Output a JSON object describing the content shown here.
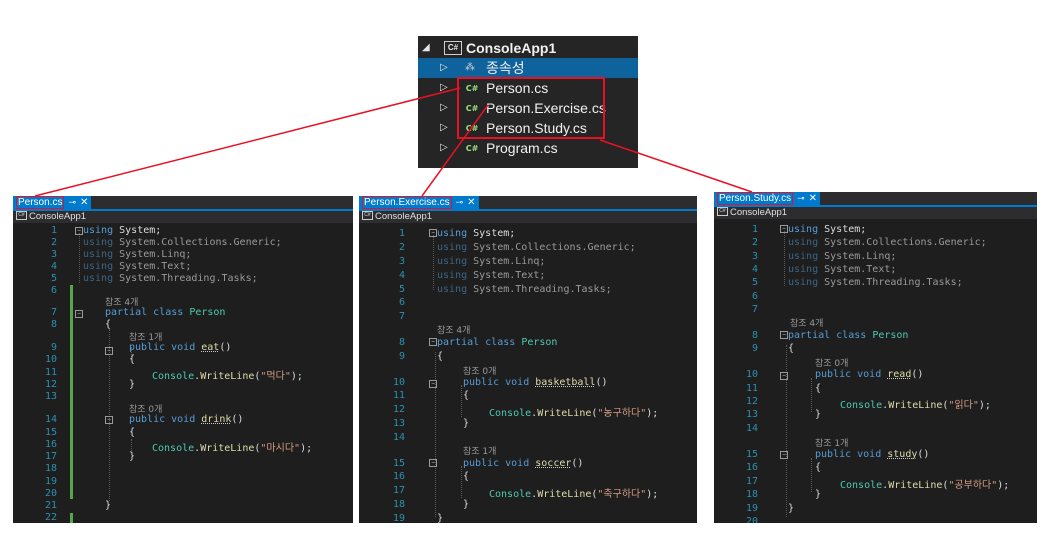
{
  "solution_explorer": {
    "project": "ConsoleApp1",
    "dependencies": "종속성",
    "files": [
      "Person.cs",
      "Person.Exercise.cs",
      "Person.Study.cs",
      "Program.cs"
    ],
    "file_badge": "C#",
    "project_badge": "C#"
  },
  "editors": [
    {
      "tab": "Person.cs",
      "project": "ConsoleApp1",
      "refs_class": "참조 4개",
      "refs_m1": "참조 1개",
      "refs_m2": "참조 0개",
      "lines": [
        "1",
        "2",
        "3",
        "4",
        "5",
        "6",
        "7",
        "8",
        "9",
        "10",
        "11",
        "12",
        "13",
        "14",
        "15",
        "16",
        "17",
        "18",
        "19",
        "20",
        "21",
        "22"
      ]
    },
    {
      "tab": "Person.Exercise.cs",
      "project": "ConsoleApp1",
      "refs_class": "참조 4개",
      "refs_m1": "참조 0개",
      "refs_m2": "참조 1개",
      "lines": [
        "1",
        "2",
        "3",
        "4",
        "5",
        "6",
        "7",
        "8",
        "9",
        "10",
        "11",
        "12",
        "13",
        "14",
        "15",
        "16",
        "17",
        "18",
        "19"
      ]
    },
    {
      "tab": "Person.Study.cs",
      "project": "ConsoleApp1",
      "refs_class": "참조 4개",
      "refs_m1": "참조 0개",
      "refs_m2": "참조 1개",
      "lines": [
        "1",
        "2",
        "3",
        "4",
        "5",
        "6",
        "7",
        "8",
        "9",
        "10",
        "11",
        "12",
        "13",
        "14",
        "15",
        "16",
        "17",
        "18",
        "19",
        "20"
      ]
    }
  ],
  "code": {
    "using": "using",
    "system": "System;",
    "ns": [
      "System.Collections.Generic;",
      "System.Linq;",
      "System.Text;",
      "System.Threading.Tasks;"
    ],
    "partial_class": "partial class",
    "class_name": "Person",
    "public_void": "public void",
    "console": "Console",
    "writeline": "WriteLine",
    "open": "{",
    "close": "}",
    "m1": {
      "eat": "eat",
      "drink": "drink",
      "basketball": "basketball",
      "soccer": "soccer",
      "read": "read",
      "study": "study"
    },
    "str": {
      "eat": "\"먹다\"",
      "drink": "\"마시다\"",
      "basketball": "\"농구하다\"",
      "soccer": "\"축구하다\"",
      "read": "\"읽다\"",
      "study": "\"공부하다\""
    }
  },
  "colors": {
    "keyword": "#569cd6",
    "class": "#4ec9b0",
    "string": "#d69d85",
    "method": "#dcdcaa",
    "line_number": "#2b91af",
    "highlight_red": "#e81123",
    "accent": "#007acc"
  }
}
